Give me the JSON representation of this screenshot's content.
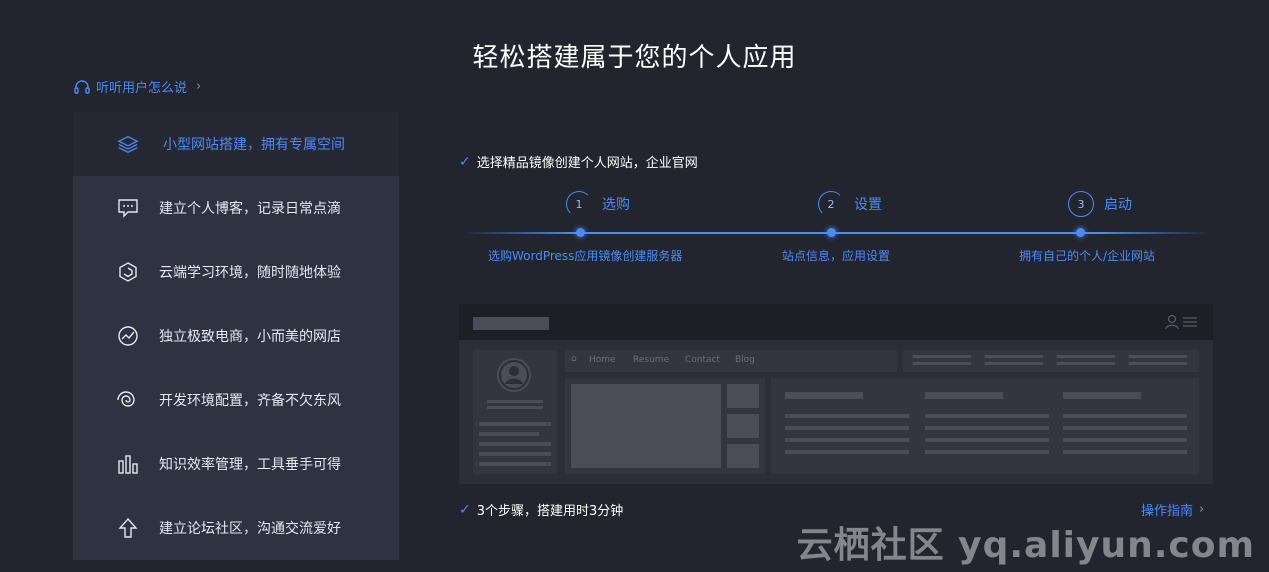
{
  "title": "轻松搭建属于您的个人应用",
  "listen_link": "听听用户怎么说",
  "sidebar": {
    "items": [
      {
        "label": "小型网站搭建，拥有专属空间",
        "icon": "layers-icon"
      },
      {
        "label": "建立个人博客，记录日常点滴",
        "icon": "chat-bubble-icon"
      },
      {
        "label": "云端学习环境，随时随地体验",
        "icon": "hexagon-icon"
      },
      {
        "label": "独立极致电商，小而美的网店",
        "icon": "trend-circle-icon"
      },
      {
        "label": "开发环境配置，齐备不欠东风",
        "icon": "spiral-icon"
      },
      {
        "label": "知识效率管理，工具垂手可得",
        "icon": "bar-chart-icon"
      },
      {
        "label": "建立论坛社区，沟通交流爱好",
        "icon": "arrow-up-icon"
      }
    ]
  },
  "main": {
    "headline": "选择精品镜像创建个人网站，企业官网",
    "steps": [
      {
        "num": "1",
        "label": "选购",
        "desc": "选购WordPress应用镜像创建服务器"
      },
      {
        "num": "2",
        "label": "设置",
        "desc": "站点信息，应用设置"
      },
      {
        "num": "3",
        "label": "启动",
        "desc": "拥有自己的个人/企业网站"
      }
    ],
    "preview": {
      "nav": [
        "Home",
        "Resume",
        "Contact",
        "Blog"
      ]
    },
    "footer_note": "3个步骤，搭建用时3分钟",
    "guide_link": "操作指南"
  },
  "watermark": "云栖社区 yq.aliyun.com",
  "colors": {
    "accent": "#4c8bf5",
    "bg": "#22242e",
    "sidebar": "#2f3240"
  }
}
